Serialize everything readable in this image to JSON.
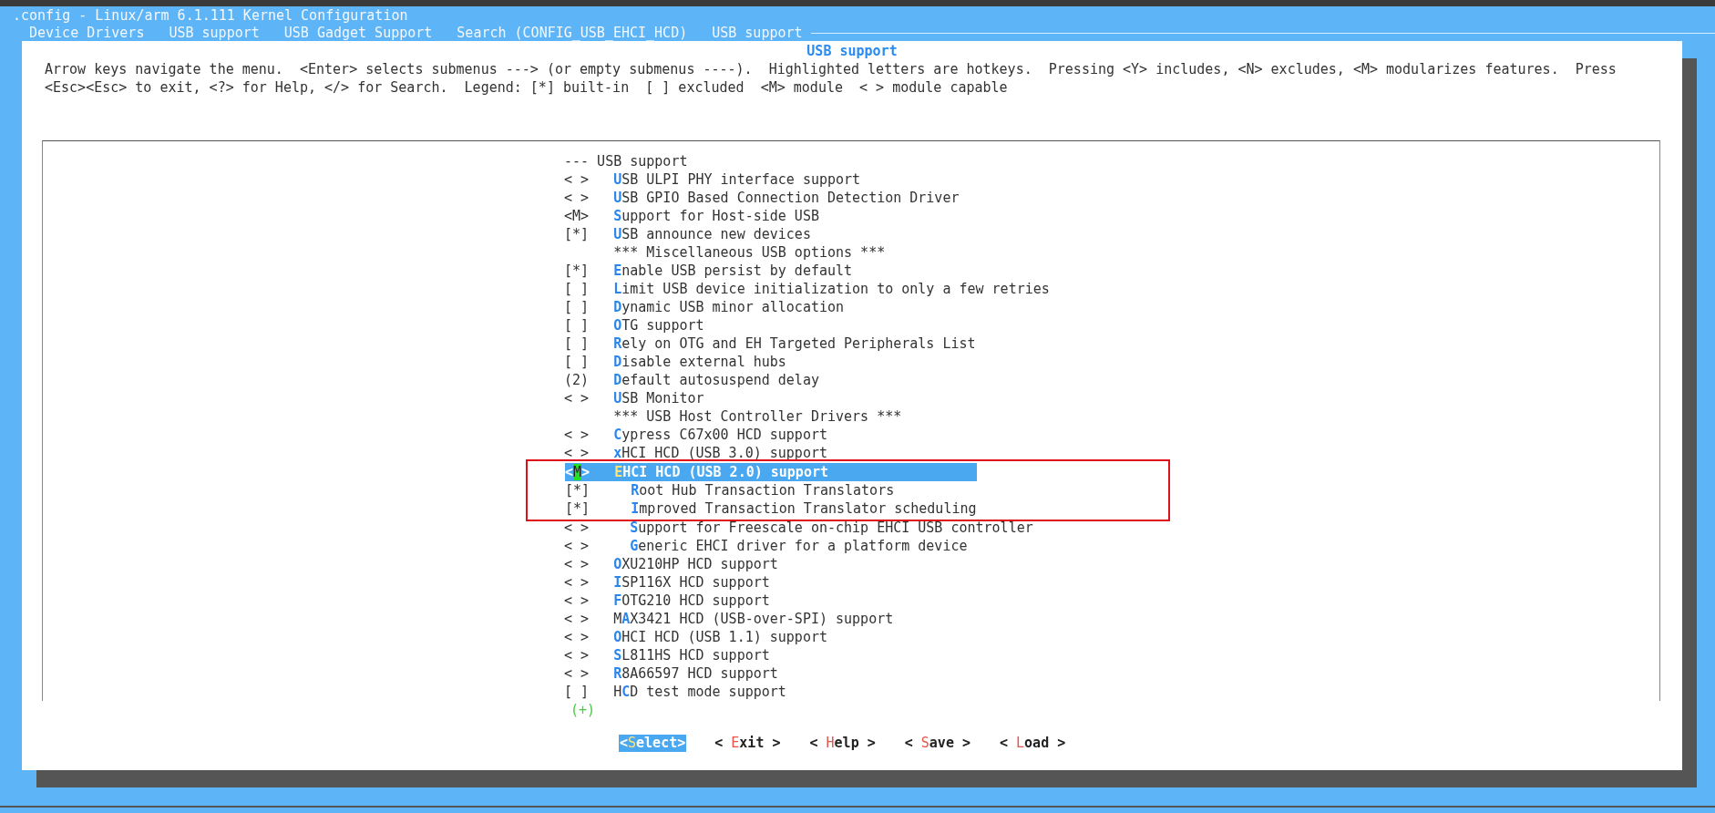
{
  "window": {
    "title": ".config - Linux/arm 6.1.111 Kernel Configuration"
  },
  "breadcrumb": [
    "Device Drivers",
    "USB support",
    "USB Gadget Support",
    "Search (CONFIG_USB_EHCI_HCD)",
    "USB support"
  ],
  "dialog": {
    "title": "USB support",
    "help_lines": [
      "Arrow keys navigate the menu.  <Enter> selects submenus ---> (or empty submenus ----).  Highlighted letters are hotkeys.  Pressing <Y> includes, <N> excludes, <M> modularizes features.  Press",
      "<Esc><Esc> to exit, <?> for Help, </> for Search.  Legend: [*] built-in  [ ] excluded  <M> module  < > module capable"
    ]
  },
  "items": [
    {
      "kind": "header",
      "prefix": "---",
      "label": "USB support",
      "selected": false
    },
    {
      "prefix": "< >",
      "label": "**U**SB ULPI PHY interface support",
      "selected": false
    },
    {
      "prefix": "< >",
      "label": "**U**SB GPIO Based Connection Detection Driver",
      "selected": false
    },
    {
      "prefix": "<M>",
      "label": "**S**upport for Host-side USB",
      "selected": false
    },
    {
      "prefix": "[*]",
      "label": "**U**SB announce new devices",
      "selected": false
    },
    {
      "kind": "comment",
      "label": "*** Miscellaneous USB options ***",
      "selected": false
    },
    {
      "prefix": "[*]",
      "label": "**E**nable USB persist by default",
      "selected": false
    },
    {
      "prefix": "[ ]",
      "label": "**L**imit USB device initialization to only a few retries",
      "selected": false
    },
    {
      "prefix": "[ ]",
      "label": "**D**ynamic USB minor allocation",
      "selected": false
    },
    {
      "prefix": "[ ]",
      "label": "**O**TG support",
      "selected": false
    },
    {
      "prefix": "[ ]",
      "label": "**R**ely on OTG and EH Targeted Peripherals List",
      "selected": false
    },
    {
      "prefix": "[ ]",
      "label": "**D**isable external hubs",
      "selected": false
    },
    {
      "prefix": "(2)",
      "label": "**D**efault autosuspend delay",
      "selected": false
    },
    {
      "prefix": "< >",
      "label": "**U**SB Monitor",
      "selected": false
    },
    {
      "kind": "comment",
      "label": "*** USB Host Controller Drivers ***",
      "selected": false
    },
    {
      "prefix": "< >",
      "label": "**C**ypress C67x00 HCD support",
      "selected": false
    },
    {
      "prefix": "< >",
      "label": "**x**HCI HCD (USB 3.0) support",
      "selected": false
    },
    {
      "prefix": "<**M**>",
      "label": "**E**HCI HCD (USB 2.0) support",
      "selected": true,
      "annotated": true,
      "children": [
        {
          "prefix": "[*]",
          "label": "**R**oot Hub Transaction Translators",
          "selected": false
        },
        {
          "prefix": "[*]",
          "label": "**I**mproved Transaction Translator scheduling",
          "selected": false
        }
      ]
    },
    {
      "prefix": "< >",
      "label": "**S**upport for Freescale on-chip EHCI USB controller",
      "selected": false,
      "indented": true
    },
    {
      "prefix": "< >",
      "label": "**G**eneric EHCI driver for a platform device",
      "selected": false,
      "indented": true
    },
    {
      "prefix": "< >",
      "label": "**O**XU210HP HCD support",
      "selected": false
    },
    {
      "prefix": "< >",
      "label": "**I**SP116X HCD support",
      "selected": false
    },
    {
      "prefix": "< >",
      "label": "**F**OTG210 HCD support",
      "selected": false
    },
    {
      "prefix": "< >",
      "label": "M**A**X3421 HCD (USB-over-SPI) support",
      "selected": false
    },
    {
      "prefix": "< >",
      "label": "**O**HCI HCD (USB 1.1) support",
      "selected": false
    },
    {
      "prefix": "< >",
      "label": "**S**L811HS HCD support",
      "selected": false
    },
    {
      "prefix": "< >",
      "label": "**R**8A66597 HCD support",
      "selected": false
    },
    {
      "prefix": "[ ]",
      "label": "H**C**D test mode support",
      "selected": false
    }
  ],
  "more_indicator": "(+)",
  "buttons": [
    {
      "label": "<**S**elect>",
      "selected": true
    },
    {
      "label": "< **E**xit >",
      "selected": false
    },
    {
      "label": "< **H**elp >",
      "selected": false
    },
    {
      "label": "< **S**ave >",
      "selected": false
    },
    {
      "label": "< **L**oad >",
      "selected": false
    }
  ]
}
